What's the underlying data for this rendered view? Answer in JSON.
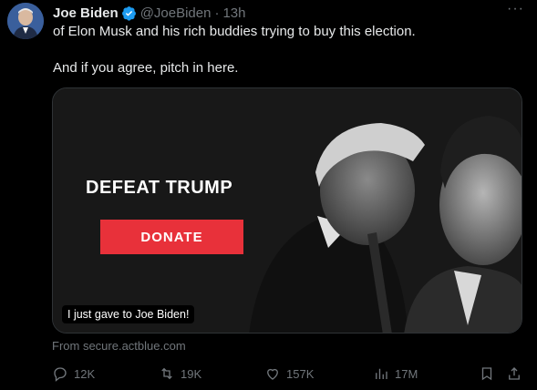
{
  "tweet": {
    "author_name": "Joe Biden",
    "handle": "@JoeBiden",
    "separator": "·",
    "time": "13h",
    "more": "···",
    "line1": "of Elon Musk and his rich buddies trying to buy this election.",
    "line2": "And if you agree, pitch in here."
  },
  "card": {
    "headline": "DEFEAT TRUMP",
    "button": "DONATE",
    "overlay": "I just gave to Joe Biden!",
    "source": "From secure.actblue.com"
  },
  "actions": {
    "replies": "12K",
    "reposts": "19K",
    "likes": "157K",
    "views": "17M"
  },
  "colors": {
    "accent": "#1d9bf0",
    "donate": "#e8313a",
    "muted": "#71767b",
    "verified_badge": "#1d9bf0"
  }
}
